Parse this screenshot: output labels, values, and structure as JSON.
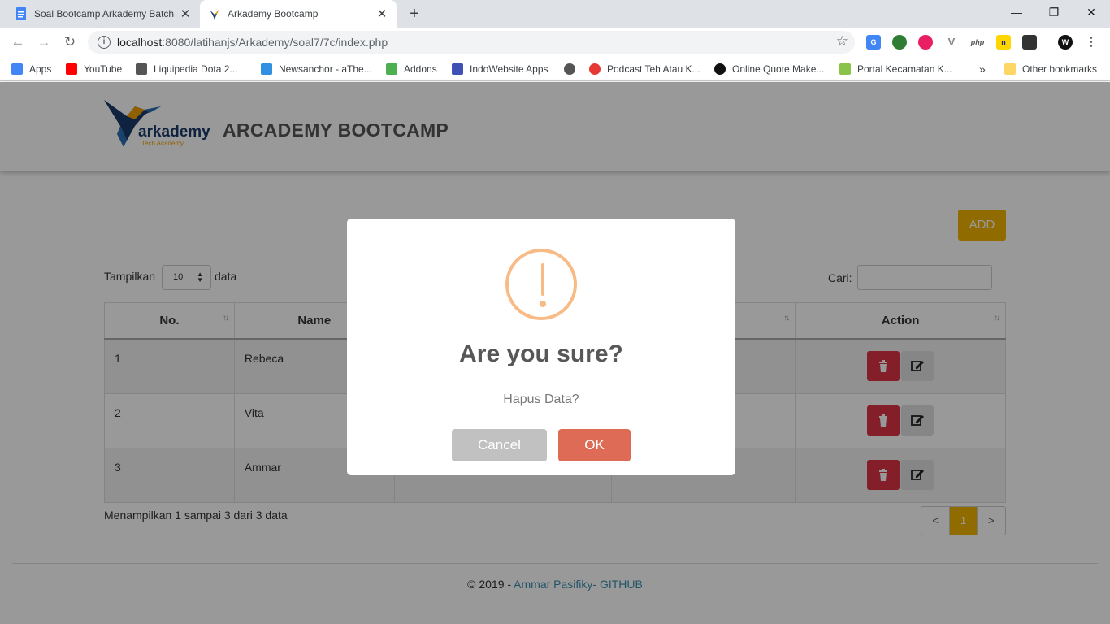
{
  "browser": {
    "tabs": [
      {
        "title": "Soal Bootcamp Arkademy Batch",
        "active": false
      },
      {
        "title": "Arkademy Bootcamp",
        "active": true
      }
    ],
    "url_host": "localhost",
    "url_path": ":8080/latihanjs/Arkademy/soal7/7c/index.php",
    "bookmarks": [
      {
        "label": "Apps",
        "color": "#4285f4"
      },
      {
        "label": "YouTube",
        "color": "#ff0000"
      },
      {
        "label": "Liquipedia Dota 2...",
        "color": "#555555"
      },
      {
        "label": "Newsanchor - aThe...",
        "color": "#2f8fe0"
      },
      {
        "label": "Addons",
        "color": "#4caf50"
      },
      {
        "label": "IndoWebsite Apps",
        "color": "#3f51b5"
      },
      {
        "label": "",
        "color": "#555555"
      },
      {
        "label": "Podcast Teh Atau K...",
        "color": "#e53935"
      },
      {
        "label": "Online Quote Make...",
        "color": "#111111"
      },
      {
        "label": "Portal Kecamatan K...",
        "color": "#8bc34a"
      }
    ],
    "bookmarks_more": "»",
    "other_bookmarks": "Other bookmarks"
  },
  "header": {
    "logo_text": "arkademy",
    "logo_sub": "Tech Academy",
    "title": "ARCADEMY BOOTCAMP"
  },
  "controls": {
    "add_label": "ADD",
    "show_label": "Tampilkan",
    "page_length": "10",
    "show_after": "data",
    "search_label": "Cari:"
  },
  "table": {
    "columns": [
      "No.",
      "Name",
      "",
      "",
      "Action"
    ],
    "rows": [
      {
        "no": "1",
        "name": "Rebeca"
      },
      {
        "no": "2",
        "name": "Vita"
      },
      {
        "no": "3",
        "name": "Ammar"
      }
    ],
    "info": "Menampilkan 1 sampai 3 dari 3 data"
  },
  "pagination": {
    "prev": "<",
    "current": "1",
    "next": ">"
  },
  "footer": {
    "copyright": "© 2019 - ",
    "author_link": "Ammar Pasifiky- GITHUB"
  },
  "dialog": {
    "title": "Are you sure?",
    "text": "Hapus Data?",
    "cancel_label": "Cancel",
    "ok_label": "OK"
  },
  "colors": {
    "accent": "#f0b400",
    "danger": "#dc3545",
    "warning_icon": "#f8bb86",
    "confirm": "#dd6b55"
  }
}
